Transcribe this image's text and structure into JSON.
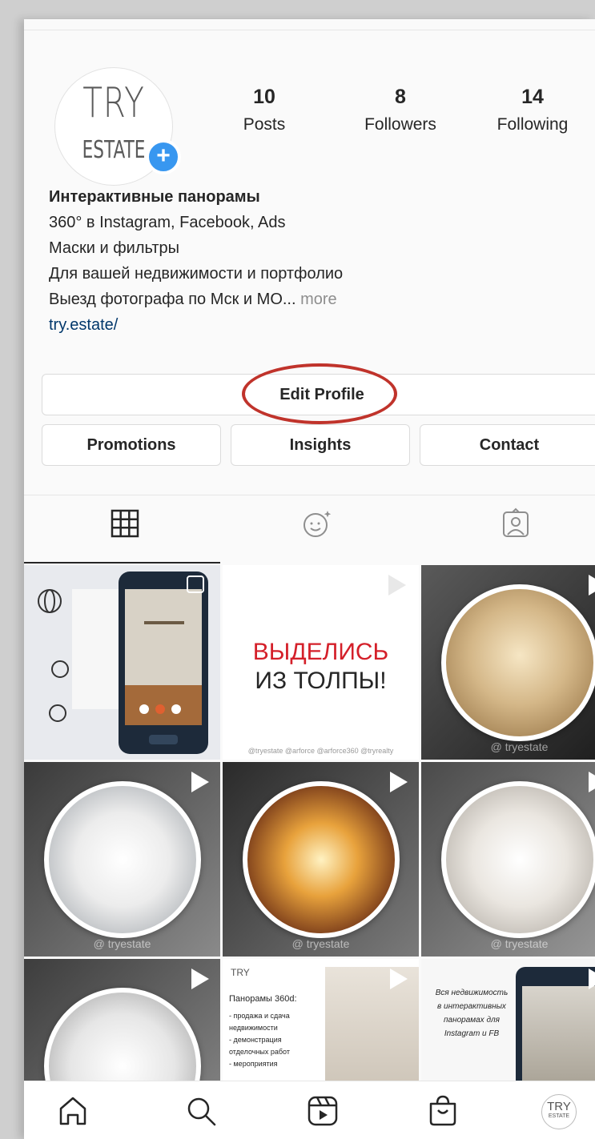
{
  "profile": {
    "avatar_line1": "TRY",
    "avatar_line2": "ESTATE",
    "stats": {
      "posts": {
        "value": "10",
        "label": "Posts"
      },
      "followers": {
        "value": "8",
        "label": "Followers"
      },
      "following": {
        "value": "14",
        "label": "Following"
      }
    },
    "bio": {
      "name": "Интерактивные панорамы",
      "line1": "360° в Instagram, Facebook, Ads",
      "line2": "Маски и фильтры",
      "line3": "Для вашей недвижимости и портфолио",
      "line4": "Выезд фотографа по Мск и МО...",
      "more": " more",
      "link": "try.estate/"
    }
  },
  "buttons": {
    "edit_profile": "Edit Profile",
    "promotions": "Promotions",
    "insights": "Insights",
    "contact": "Contact"
  },
  "tabs": {
    "grid": "grid-icon",
    "effects": "face-sparkle-icon",
    "tagged": "tagged-person-icon"
  },
  "posts": {
    "p2_line1": "ВЫДЕЛИСЬ",
    "p2_line2": "ИЗ ТОЛПЫ!",
    "p2_footer": "@tryestate @arforce @arforce360 @tryrealty",
    "watermark": "@ tryestate",
    "p8_brand": "TRY",
    "p8_title": "Панорамы 360d:",
    "p8_items": [
      "- продажа и сдача",
      "недвижимости",
      "- демонстрация",
      "отделочных работ",
      "- мероприятия"
    ],
    "p9_text": [
      "Вся недвижимость",
      "в интерактивных",
      "панорамах для",
      "Instagram и FB"
    ]
  },
  "bottom_nav": [
    "home-icon",
    "search-icon",
    "reels-icon",
    "shop-icon",
    "profile-avatar"
  ],
  "nav_avatar": {
    "line1": "TRY",
    "line2": "ESTATE"
  },
  "colors": {
    "accent_blue": "#3897f0",
    "link": "#00376b",
    "annotation_red": "#c0332b",
    "post2_red": "#d4202a"
  }
}
